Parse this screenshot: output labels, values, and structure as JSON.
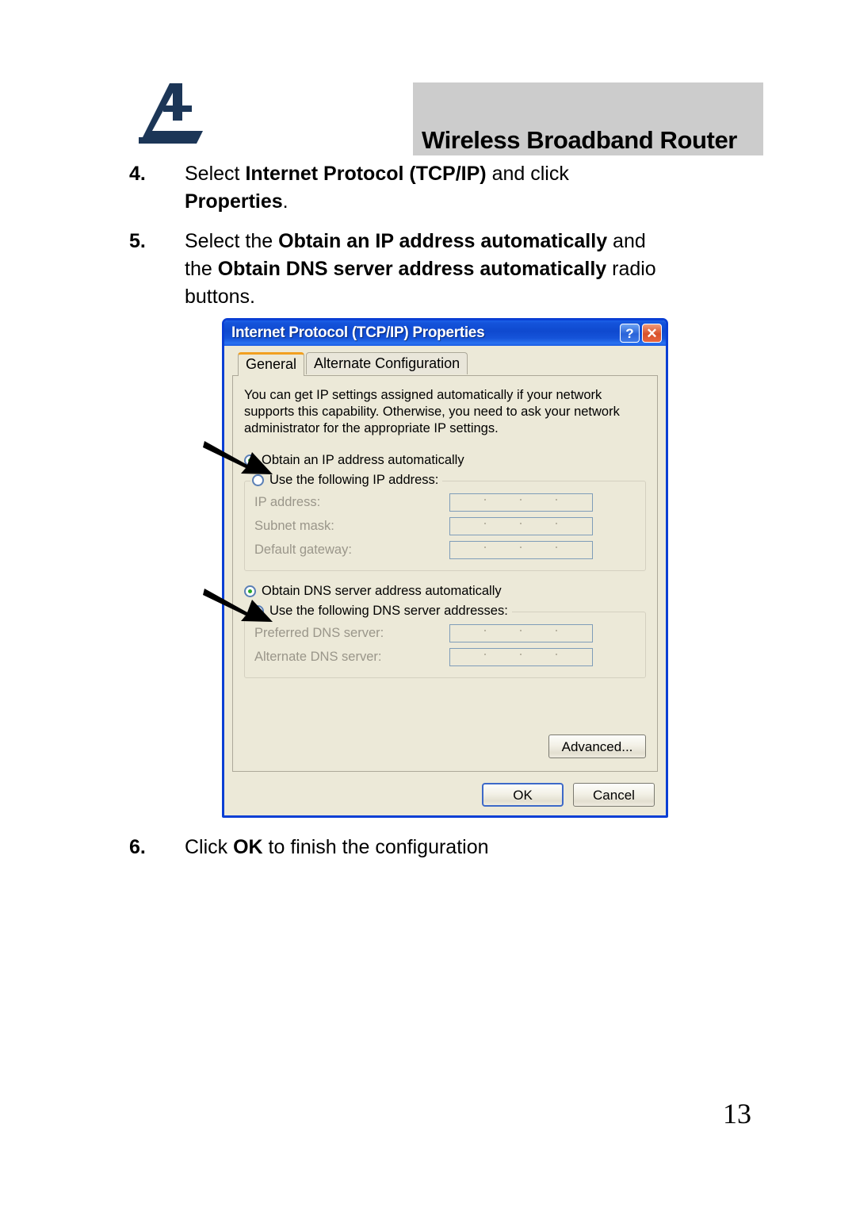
{
  "header": {
    "logo_name": "atlantis-land-logo",
    "band_color": "#cccccc",
    "title": "Wireless Broadband Router"
  },
  "steps": {
    "step4": {
      "number": "4.",
      "line1_a": "Select ",
      "line1_b": "Internet Protocol (TCP/IP)",
      "line1_c": " and click",
      "line2_b": "Properties",
      "line2_c": "."
    },
    "step5": {
      "number": "5.",
      "line1_a": "Select the ",
      "line1_b": "Obtain an IP address automatically",
      "line1_c": " and",
      "line2_a": "the ",
      "line2_b": "Obtain DNS server address automatically",
      "line2_c": " radio",
      "line3_a": "buttons."
    },
    "step6": {
      "number": "6.",
      "text_a": "Click ",
      "text_b": "OK",
      "text_c": " to finish the configuration"
    }
  },
  "page_number": "13",
  "dialog": {
    "title": "Internet Protocol (TCP/IP) Properties",
    "help_button": "?",
    "close_button": "✕",
    "tabs": [
      {
        "label": "General",
        "active": true
      },
      {
        "label": "Alternate Configuration",
        "active": false
      }
    ],
    "intro_text": "You can get IP settings assigned automatically if your network supports this capability. Otherwise, you need to ask your network administrator for the appropriate IP settings.",
    "ip_section": {
      "auto_radio_label": "Obtain an IP address automatically",
      "auto_radio_selected": true,
      "manual_radio_label": "Use the following IP address:",
      "manual_radio_selected": false,
      "fields": [
        {
          "label": "IP address:",
          "value": ""
        },
        {
          "label": "Subnet mask:",
          "value": ""
        },
        {
          "label": "Default gateway:",
          "value": ""
        }
      ]
    },
    "dns_section": {
      "auto_radio_label": "Obtain DNS server address automatically",
      "auto_radio_selected": true,
      "manual_radio_label": "Use the following DNS server addresses:",
      "manual_radio_selected": false,
      "fields": [
        {
          "label": "Preferred DNS server:",
          "value": ""
        },
        {
          "label": "Alternate DNS server:",
          "value": ""
        }
      ]
    },
    "advanced_button": "Advanced...",
    "ok_button": "OK",
    "cancel_button": "Cancel",
    "colors": {
      "titlebar_blue": "#0f49cf",
      "window_face": "#ece9d8",
      "active_tab_accent": "#f2a020",
      "radio_selected_dot": "#2aa82a",
      "field_border": "#7f9db9",
      "close_button_red": "#d8512a"
    }
  },
  "callouts": [
    {
      "name": "arrow-to-obtain-ip-radio"
    },
    {
      "name": "arrow-to-obtain-dns-radio"
    }
  ]
}
